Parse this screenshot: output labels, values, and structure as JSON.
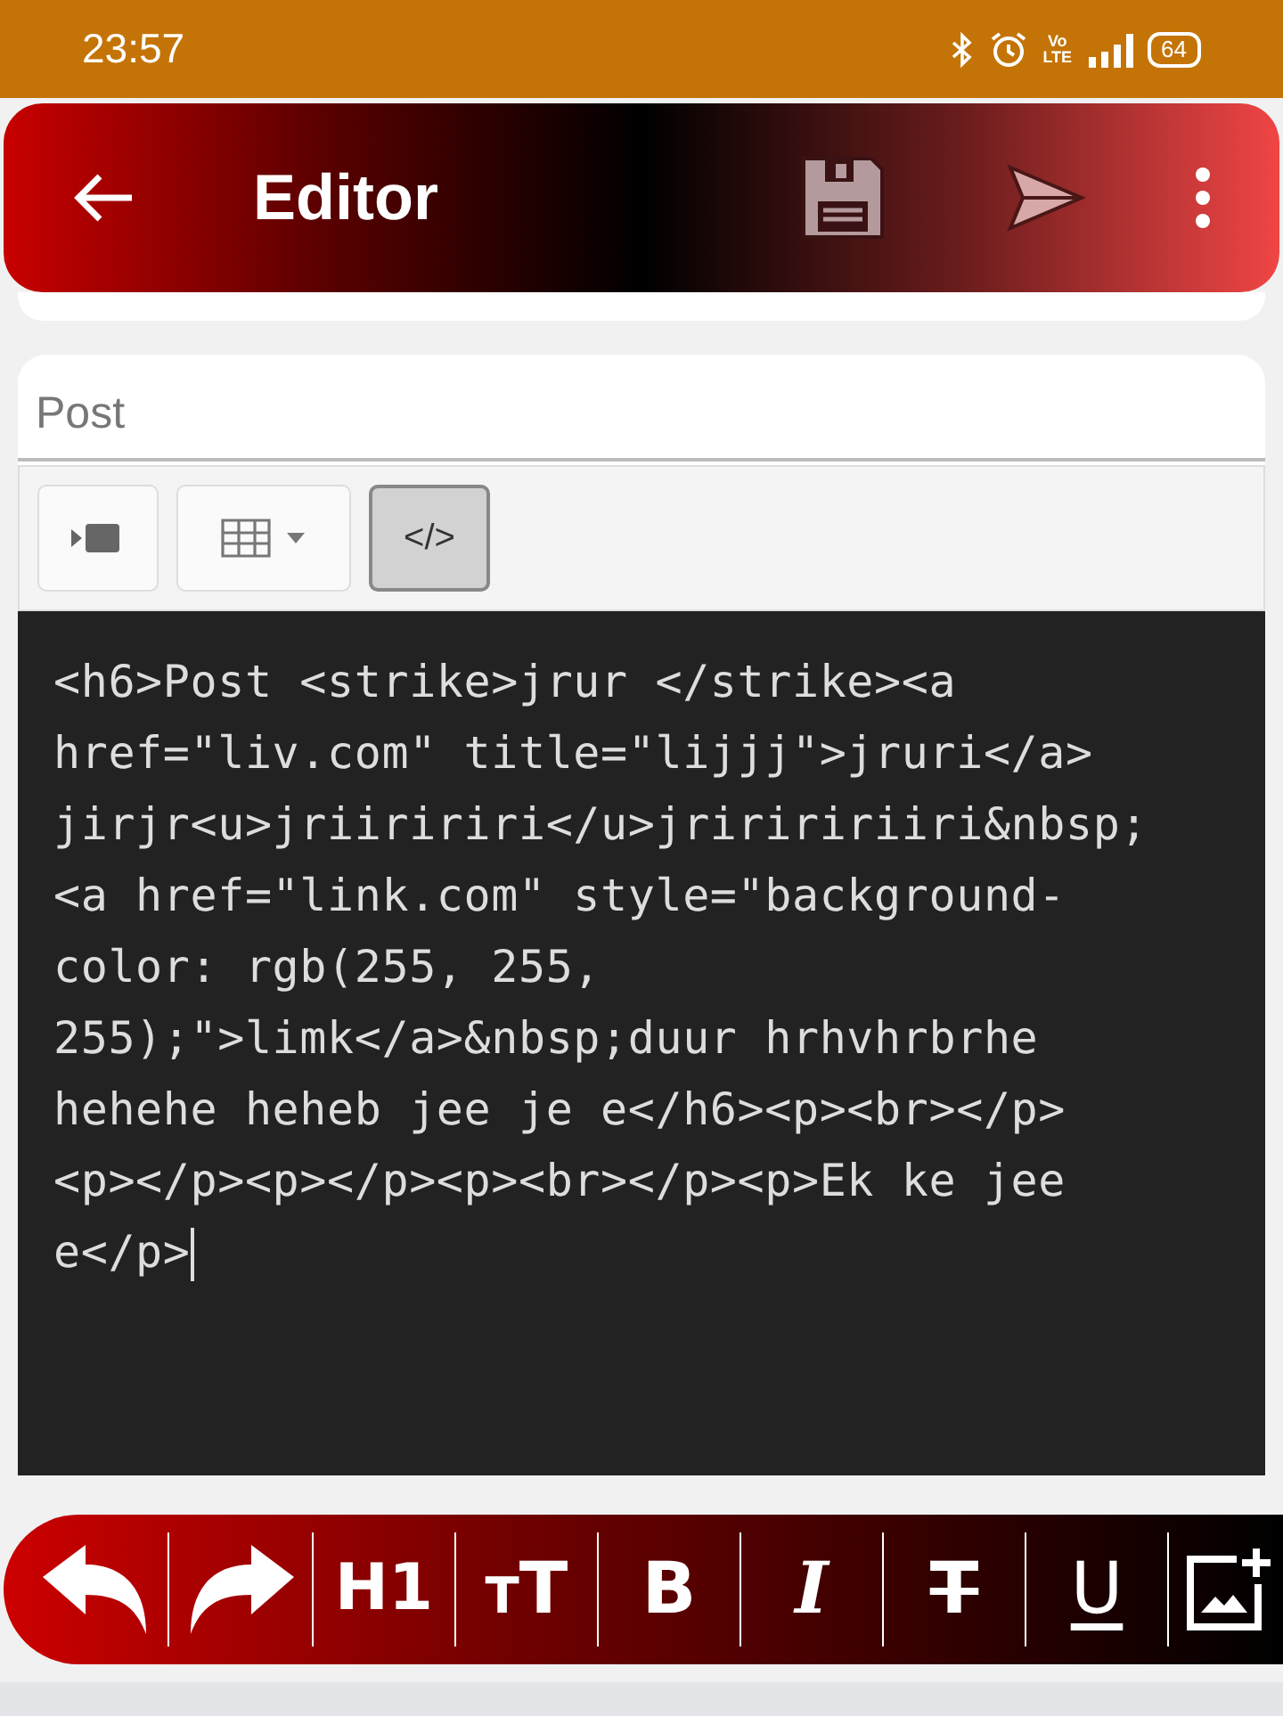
{
  "status_bar": {
    "time": "23:57",
    "volte": [
      "Vo",
      "LTE"
    ],
    "battery": "64"
  },
  "app_bar": {
    "title": "Editor"
  },
  "post_field": {
    "placeholder": "Post"
  },
  "editor_toolbar": [
    {
      "kind": "video",
      "selected": false
    },
    {
      "kind": "table",
      "selected": false
    },
    {
      "kind": "code",
      "label": "</>",
      "selected": true
    }
  ],
  "code_lines": [
    "<h6>Post <strike>jrur </strike><a",
    "href=\"liv.com\" title=\"lijjj\">jruri</a>",
    "jirjr<u>jriiririri</u>jririririiri&nbsp;",
    "<a href=\"link.com\" style=\"background-",
    "color: rgb(255, 255,",
    "255);\">limk</a>&nbsp;duur hrhvhrbrhe",
    "hehehe heheb jee je e</h6><p><br></p>",
    "<p></p><p></p><p><br></p><p>Ek ke jee",
    "e</p>"
  ],
  "format_bar": [
    {
      "kind": "undo"
    },
    {
      "kind": "redo"
    },
    {
      "kind": "heading",
      "label": "H1"
    },
    {
      "kind": "size",
      "label": "TT"
    },
    {
      "kind": "bold",
      "label": "B"
    },
    {
      "kind": "italic",
      "label": "I"
    },
    {
      "kind": "strike",
      "label": "T"
    },
    {
      "kind": "underline",
      "label": "U"
    },
    {
      "kind": "image"
    }
  ]
}
